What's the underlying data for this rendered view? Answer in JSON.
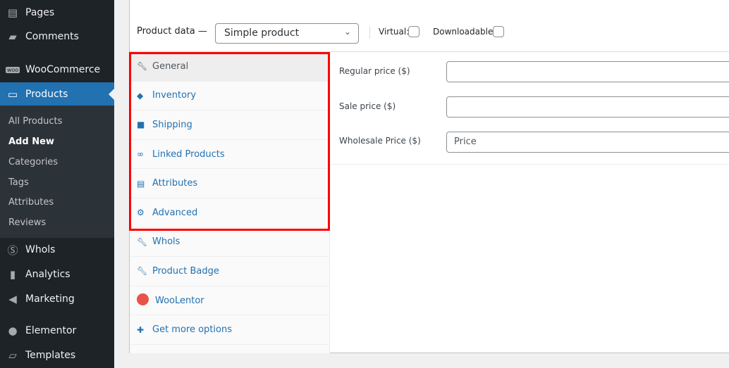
{
  "sidebar": {
    "items": [
      {
        "label": "Pages",
        "icon": "pages-icon"
      },
      {
        "label": "Comments",
        "icon": "comments-icon"
      },
      {
        "label": "WooCommerce",
        "icon": "woocommerce-icon"
      },
      {
        "label": "Products",
        "icon": "products-icon",
        "active": true
      },
      {
        "label": "Whols",
        "icon": "dollar-icon"
      },
      {
        "label": "Analytics",
        "icon": "analytics-icon"
      },
      {
        "label": "Marketing",
        "icon": "megaphone-icon"
      },
      {
        "label": "Elementor",
        "icon": "elementor-icon"
      },
      {
        "label": "Templates",
        "icon": "folder-icon"
      }
    ],
    "submenu": [
      "All Products",
      "Add New",
      "Categories",
      "Tags",
      "Attributes",
      "Reviews"
    ],
    "current_submenu": "Add New"
  },
  "product_data": {
    "label": "Product data —",
    "type": "Simple product",
    "virtual_label": "Virtual:",
    "downloadable_label": "Downloadable:",
    "virtual": false,
    "downloadable": false
  },
  "tabs": [
    "General",
    "Inventory",
    "Shipping",
    "Linked Products",
    "Attributes",
    "Advanced",
    "Whols",
    "Product Badge",
    "WooLentor",
    "Get more options"
  ],
  "active_tab": "General",
  "fields": [
    {
      "label": "Regular price ($)",
      "value": "",
      "placeholder": ""
    },
    {
      "label": "Sale price ($)",
      "value": "",
      "placeholder": ""
    },
    {
      "label": "Wholesale Price ($)",
      "value": "",
      "placeholder": "Price"
    }
  ],
  "colors": {
    "accent": "#2271b1",
    "highlight": "#ff0000",
    "sidebar": "#1d2327"
  }
}
